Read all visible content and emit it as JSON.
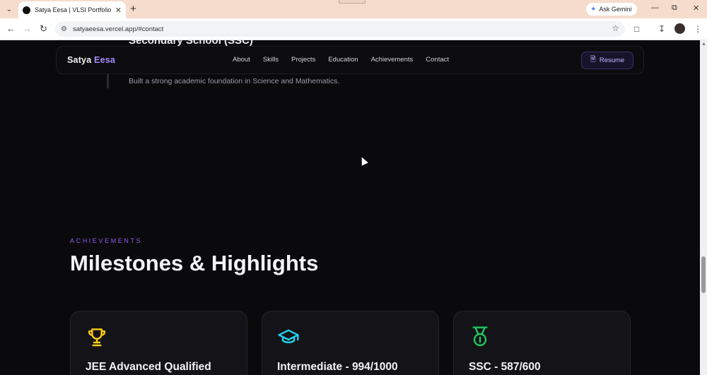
{
  "browser": {
    "tab_title": "Satya Eesa | VLSI Portfolio",
    "url": "satyaeesa.vercel.app/#contact",
    "gemini_label": "Ask Gemini"
  },
  "page": {
    "education": {
      "partial_title": "Secondary School (SSC)",
      "description": "Built a strong academic foundation in Science and Mathematics."
    },
    "navbar": {
      "brand_first": "Satya",
      "brand_second": "Eesa",
      "links": [
        "About",
        "Skills",
        "Projects",
        "Education",
        "Achievements",
        "Contact"
      ],
      "resume_label": "Resume"
    },
    "achievements": {
      "label": "ACHIEVEMENTS",
      "title": "Milestones & Highlights",
      "cards": [
        {
          "title": "JEE Advanced Qualified",
          "icon": "trophy-icon",
          "color": "#facc15"
        },
        {
          "title": "Intermediate - 994/1000",
          "icon": "graduation-cap-icon",
          "color": "#22d3ee"
        },
        {
          "title": "SSC - 587/600",
          "icon": "medal-icon",
          "color": "#22c55e"
        }
      ]
    }
  },
  "colors": {
    "accent": "#a78bfa",
    "background": "#0a0a0c",
    "card": "#141418"
  }
}
